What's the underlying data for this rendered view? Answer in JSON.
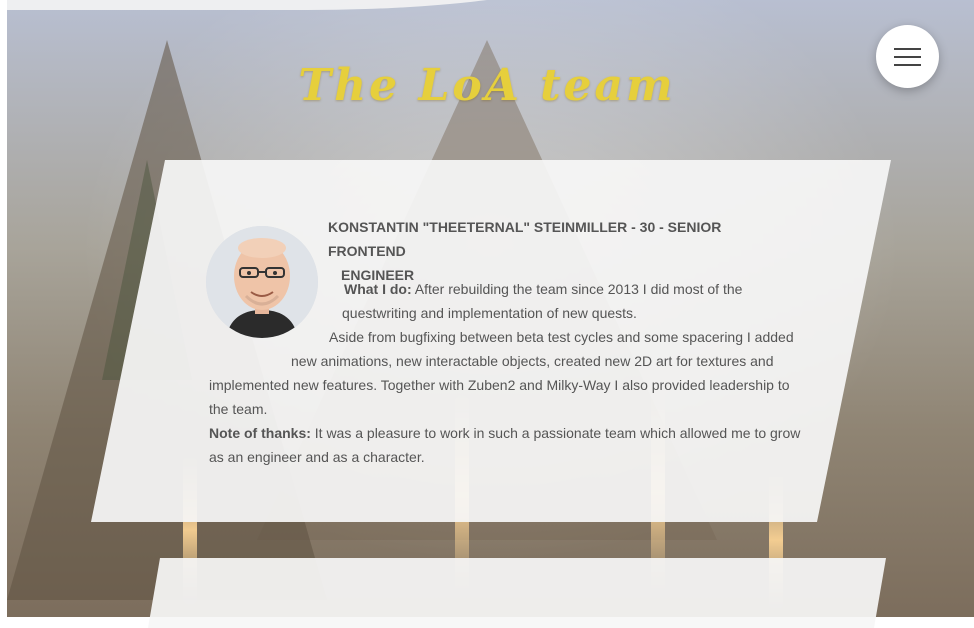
{
  "header": {
    "title": "The LoA team"
  },
  "menu": {
    "icon": "hamburger-menu-icon"
  },
  "member": {
    "heading_line1": "KONSTANTIN \"THEETERNAL\" STEINMILLER - 30 - SENIOR FRONTEND",
    "heading_line2": "ENGINEER",
    "what_label": "What I do:",
    "what_text_1": "After rebuilding the team since 2013 I did most of the",
    "what_text_2": "questwriting and implementation of new quests.",
    "aside_text_1": "Aside from bugfixing between beta test cycles and some spacering I added",
    "aside_text_2": "new animations, new interactable objects, created new 2D art for textures and",
    "aside_text_3": "implemented new features. Together with Zuben2 and Milky-Way I also provided leadership to",
    "aside_text_4": "the team.",
    "thanks_label": "Note of thanks:",
    "thanks_text_1": "It was a pleasure to work in such a passionate team which allowed me to grow",
    "thanks_text_2": "as an engineer and as a character."
  },
  "colors": {
    "title": "#e6cf3c",
    "card": "#f6f6f6",
    "text": "#555555"
  }
}
